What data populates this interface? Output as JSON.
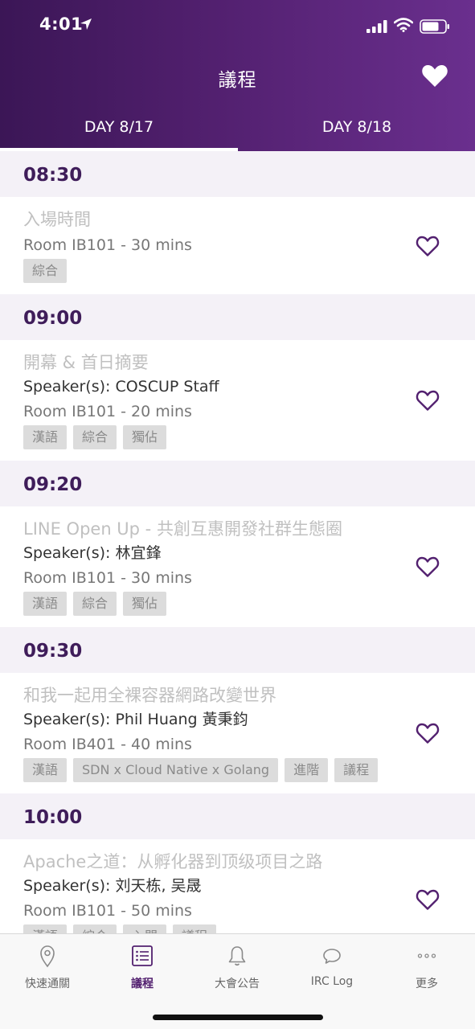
{
  "status_bar": {
    "time": "4:01"
  },
  "header": {
    "title": "議程"
  },
  "tabs": [
    {
      "label": "DAY 8/17",
      "active": true
    },
    {
      "label": "DAY 8/18",
      "active": false
    }
  ],
  "colors": {
    "primary": "#52206f",
    "accent": "#6a2f8e",
    "time_header_bg": "#f4f1f7"
  },
  "schedule": [
    {
      "time": "08:30",
      "sessions": [
        {
          "title": "入場時間",
          "speaker": "",
          "room": "Room IB101 - 30 mins",
          "tags": [
            "綜合"
          ]
        }
      ]
    },
    {
      "time": "09:00",
      "sessions": [
        {
          "title": "開幕 & 首日摘要",
          "speaker": "Speaker(s): COSCUP Staff",
          "room": "Room IB101 - 20 mins",
          "tags": [
            "漢語",
            "綜合",
            "獨佔"
          ]
        }
      ]
    },
    {
      "time": "09:20",
      "sessions": [
        {
          "title": "LINE Open Up - 共創互惠開發社群生態圈",
          "speaker": "Speaker(s): 林宜鋒",
          "room": "Room IB101 - 30 mins",
          "tags": [
            "漢語",
            "綜合",
            "獨佔"
          ]
        }
      ]
    },
    {
      "time": "09:30",
      "sessions": [
        {
          "title": "和我一起用全裸容器網路改變世界",
          "speaker": "Speaker(s): Phil Huang 黃秉鈞",
          "room": "Room IB401 - 40 mins",
          "tags": [
            "漢語",
            "SDN x Cloud Native x Golang",
            "進階",
            "議程"
          ]
        }
      ]
    },
    {
      "time": "10:00",
      "sessions": [
        {
          "title": "Apache之道：从孵化器到顶级项目之路",
          "speaker": "Speaker(s): 刘天栋, 吴晟",
          "room": "Room IB101 - 50 mins",
          "tags": [
            "漢語",
            "綜合",
            "入門",
            "議程"
          ]
        }
      ]
    }
  ],
  "tabbar": [
    {
      "label": "快速通關",
      "icon": "location-pin-icon",
      "active": false
    },
    {
      "label": "議程",
      "icon": "list-icon",
      "active": true
    },
    {
      "label": "大會公告",
      "icon": "bell-icon",
      "active": false
    },
    {
      "label": "IRC Log",
      "icon": "chat-bubble-icon",
      "active": false
    },
    {
      "label": "更多",
      "icon": "more-dots-icon",
      "active": false
    }
  ]
}
